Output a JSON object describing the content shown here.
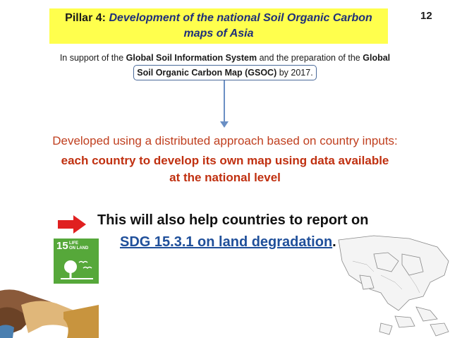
{
  "title": {
    "label": "Pillar 4:",
    "text_line1": "Development of the national Soil Organic Carbon",
    "text_line2": "maps of Asia"
  },
  "page_number": "12",
  "support": {
    "prefix": "In support of the",
    "gsis": "Global Soil Information System",
    "middle": "and the preparation of the",
    "global": "Global",
    "gsoc": "Soil Organic Carbon Map (GSOC)",
    "suffix": "by 2017."
  },
  "developed": {
    "line1": "Developed using a distributed approach based on country inputs:",
    "line2": "each country to develop its own map using data available",
    "line3": "at the national level"
  },
  "report": {
    "line1": "This will also help countries to report on",
    "sdg": "SDG 15.3.1 on land degradation",
    "period": "."
  },
  "sdg_icon": {
    "number": "15",
    "label_line1": "LIFE",
    "label_line2": "ON LAND",
    "color": "#56a83a"
  },
  "colors": {
    "title_bg": "#ffff4d",
    "accent_red": "#c04020",
    "sdg_blue": "#1f4f9a"
  }
}
